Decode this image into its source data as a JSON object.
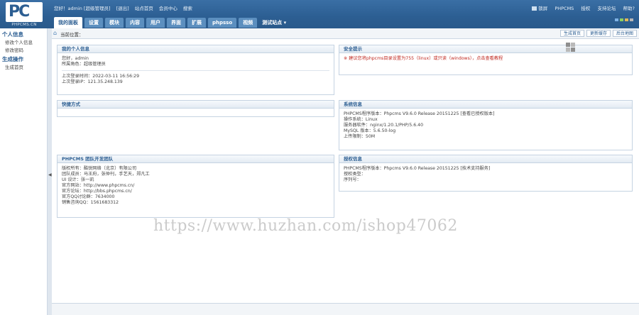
{
  "logo": {
    "letters": "PC",
    "caption": "PHPCMS.CN"
  },
  "topbar": {
    "greeting": "您好！admin [超级管理员]",
    "logout": "[退出]",
    "site_home": "站点首页",
    "member_center": "会员中心",
    "search": "搜索",
    "right_links": [
      "锁屏",
      "PHPCMS",
      "授权",
      "支持论坛",
      "帮助?"
    ]
  },
  "skins": [
    "#7fb2e5",
    "#8fcf5f",
    "#dfb85a",
    "#b7b7b7"
  ],
  "nav": {
    "tabs": [
      "我的面板",
      "设置",
      "模块",
      "内容",
      "用户",
      "界面",
      "扩展",
      "phpsso",
      "视频"
    ],
    "site_select": "测试站点 ▾"
  },
  "sidebar": {
    "sections": [
      {
        "title": "个人信息",
        "items": [
          "修改个人信息",
          "修改密码"
        ]
      },
      {
        "title": "生成操作",
        "items": [
          "生成首页"
        ]
      }
    ],
    "toggle_glyph": "◀"
  },
  "breadcrumb": {
    "label": "当前位置：",
    "buttons": [
      "生成首页",
      "更新缓存",
      "后台地图"
    ]
  },
  "panels": {
    "my_info": {
      "title": "我的个人信息",
      "hello": "您好，admin",
      "role": "所属角色：超级管理员",
      "last_login_time": "上次登录时间：2022-03-11 16:56:29",
      "last_login_ip": "上次登录IP：121.35.248.139"
    },
    "security": {
      "title": "安全提示",
      "warning": "※ 建议您将phpcms目录设置为755（linux）或只读（windows），点击查看教程"
    },
    "shortcut": {
      "title": "快捷方式"
    },
    "sysinfo": {
      "title": "系统信息",
      "lines": [
        "PHPCMS程序版本：Phpcms V9.6.0 Release 20151225 [查看已授权版本]",
        "操作系统：Linux",
        "服务器软件：nginx/1.20.1/PHP/5.6.40",
        "MySQL 版本：5.6.50-log",
        "上传限制：50M"
      ]
    },
    "team": {
      "title": "PHPCMS 团队开发团队",
      "lines": [
        "版权所有：酷锐网络（北京）有限公司",
        "团队成员：马王府，张仲刊，手艺天，郑凡工",
        "UI 设计：张一凯",
        "官方网站：http://www.phpcms.cn/",
        "官方论坛：http://bbs.phpcms.cn/",
        "官方QQ讨论群：7634000",
        "销售咨询QQ：1561683312"
      ]
    },
    "license": {
      "title": "授权信息",
      "lines": [
        "PHPCMS程序版本：Phpcms V9.6.0 Release 20151225 [技术支持服务]",
        "授权类型：",
        "序列号："
      ]
    }
  },
  "watermark": "https://www.huzhan.com/ishop47062"
}
